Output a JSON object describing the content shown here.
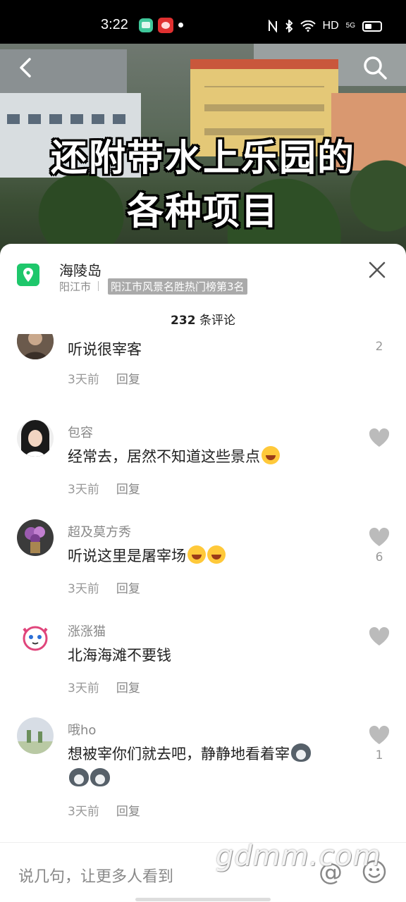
{
  "status_bar": {
    "time": "3:22",
    "network": "HD",
    "signal_label": "5G"
  },
  "video": {
    "overlay_line1": "还附带水上乐园的",
    "overlay_line2": "各种项目"
  },
  "location": {
    "title": "海陵岛",
    "city": "阳江市",
    "rank": "阳江市风景名胜热门榜第3名"
  },
  "comment_count": {
    "number": "232",
    "suffix": "条评论"
  },
  "comments": [
    {
      "user": "",
      "text": "听说很宰客",
      "time": "3天前",
      "reply": "回复",
      "likes": "2"
    },
    {
      "user": "包容",
      "text": "经常去，居然不知道这些景点",
      "time": "3天前",
      "reply": "回复",
      "likes": ""
    },
    {
      "user": "超及莫方秀",
      "text": "听说这里是屠宰场",
      "time": "3天前",
      "reply": "回复",
      "likes": "6"
    },
    {
      "user": "涨涨猫",
      "text": "北海海滩不要钱",
      "time": "3天前",
      "reply": "回复",
      "likes": ""
    },
    {
      "user": "哦ho",
      "text": "想被宰你们就去吧，静静地看着宰",
      "time": "3天前",
      "reply": "回复",
      "likes": "1"
    }
  ],
  "input": {
    "placeholder": "说几句，让更多人看到",
    "at_symbol": "@"
  },
  "watermark": "gdmm.com",
  "colors": {
    "accent_green": "#1ec76b",
    "text_primary": "#222222",
    "text_secondary": "#888888"
  }
}
